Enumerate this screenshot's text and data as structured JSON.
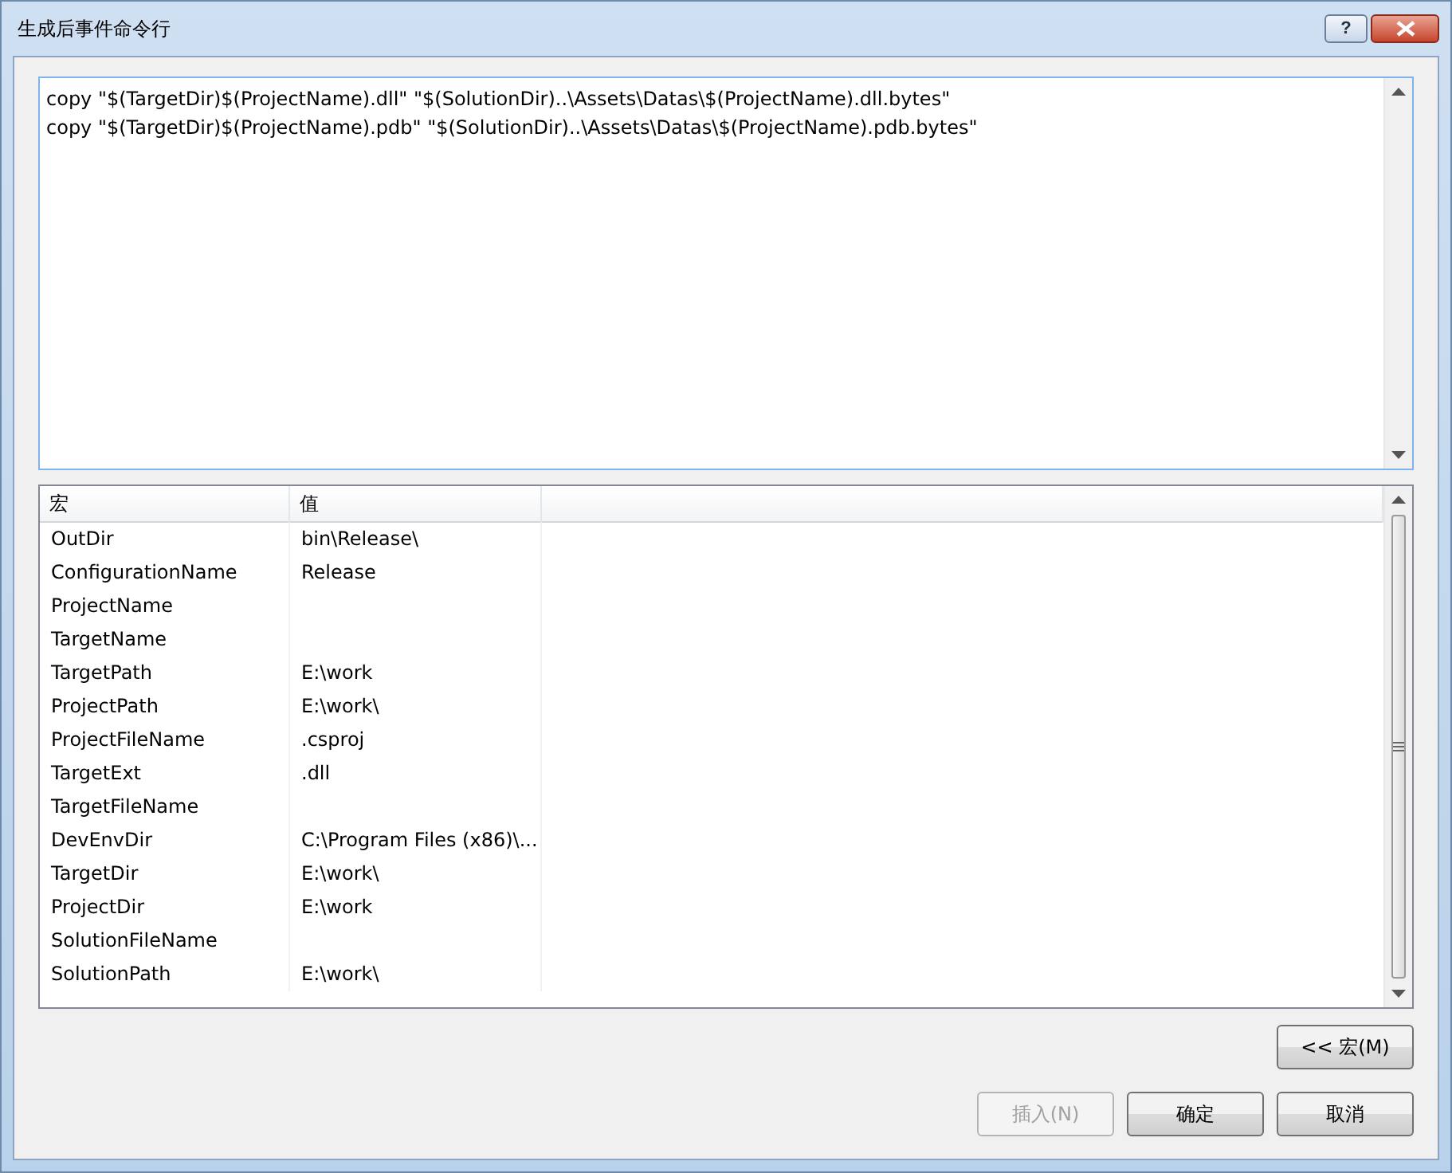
{
  "window": {
    "title": "生成后事件命令行",
    "buttons": [
      "?"
    ]
  },
  "command_lines": [
    "copy \"$(TargetDir)$(ProjectName).dll\" \"$(SolutionDir)..\\Assets\\Datas\\$(ProjectName).dll.bytes\"",
    "copy \"$(TargetDir)$(ProjectName).pdb\" \"$(SolutionDir)..\\Assets\\Datas\\$(ProjectName).pdb.bytes\""
  ],
  "table": {
    "columns": [
      "宏",
      "值"
    ],
    "rows": [
      {
        "macro": "OutDir",
        "value": "bin\\Release\\"
      },
      {
        "macro": "ConfigurationName",
        "value": "Release"
      },
      {
        "macro": "ProjectName"
      },
      {
        "macro": "TargetName"
      },
      {
        "macro": "TargetPath",
        "value": "E:\\work"
      },
      {
        "macro": "ProjectPath",
        "value": "E:\\work\\"
      },
      {
        "macro": "ProjectFileName",
        "value": ".csproj"
      },
      {
        "macro": "TargetExt",
        "value": ".dll"
      },
      {
        "macro": "TargetFileName"
      },
      {
        "macro": "DevEnvDir",
        "value": "C:\\Program Files (x86)\\..."
      },
      {
        "macro": "TargetDir",
        "value": "E:\\work\\"
      },
      {
        "macro": "ProjectDir",
        "value": "E:\\work"
      },
      {
        "macro": "SolutionFileName"
      },
      {
        "macro": "SolutionPath",
        "value": "E:\\work\\"
      }
    ]
  },
  "macro_button": "<< 宏(M)",
  "buttons": [
    {
      "label": "插入(N)",
      "disabled": true
    },
    {
      "label": "确定",
      "disabled": false
    },
    {
      "label": "取消",
      "disabled": false
    }
  ]
}
